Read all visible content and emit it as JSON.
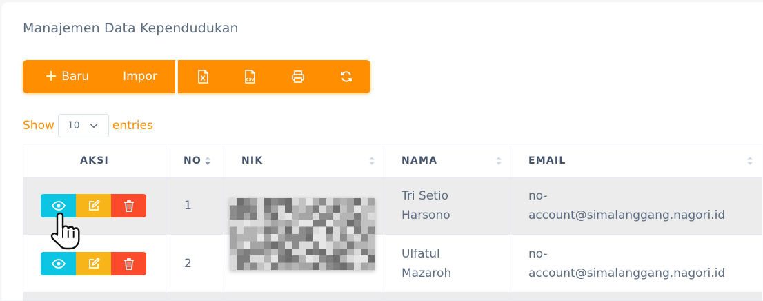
{
  "page": {
    "title": "Manajemen Data Kependudukan"
  },
  "toolbar": {
    "new_label": "Baru",
    "new_icon": "plus-icon",
    "import_label": "Impor",
    "icons": [
      "excel-icon",
      "csv-icon",
      "print-icon",
      "refresh-icon"
    ],
    "accent_color": "#ff8f00"
  },
  "entries": {
    "show_label": "Show",
    "value": "10",
    "suffix_label": "entries"
  },
  "table": {
    "columns": [
      "AKSI",
      "NO",
      "NIK",
      "NAMA",
      "EMAIL"
    ],
    "rows": [
      {
        "no": "1",
        "nama_line1": "Tri Setio",
        "nama_line2": "Harsono",
        "email_line1": "no-",
        "email_line2": "account@simalanggang.nagori.id"
      },
      {
        "no": "2",
        "nama_line1": "Ulfatul",
        "nama_line2": "Mazaroh",
        "email_line1": "no-",
        "email_line2": "account@simalanggang.nagori.id"
      }
    ],
    "action_colors": {
      "view": "#0bc5e2",
      "edit": "#f8b51a",
      "delete": "#fb4b2a"
    }
  }
}
